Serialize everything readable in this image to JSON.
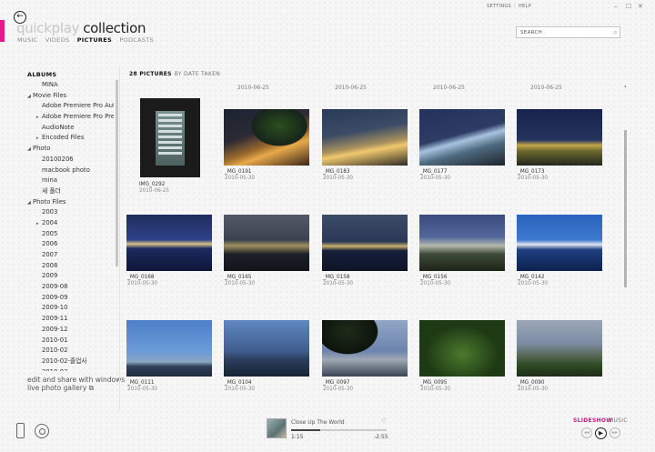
{
  "header": {
    "app_name": "quickplay",
    "section": "collection",
    "back_icon": "back-arrow-icon",
    "pivot": [
      "MUSIC",
      "VIDEOS",
      "PICTURES",
      "PODCASTS"
    ],
    "active_pivot": "PICTURES",
    "accent_color": "#e4198a"
  },
  "top_links": {
    "settings": "SETTINGS",
    "help": "HELP",
    "separator": "|"
  },
  "search": {
    "placeholder": "SEARCH",
    "icon": "search-icon"
  },
  "sidebar": {
    "title": "ALBUMS",
    "items": [
      {
        "label": "MINA",
        "indent": 1,
        "toggle": ""
      },
      {
        "label": "Movie Files",
        "indent": 0,
        "toggle": "◢"
      },
      {
        "label": "Adobe Premiere Pro Auto-Save",
        "indent": 1,
        "toggle": ""
      },
      {
        "label": "Adobe Premiere Pro Preview Files",
        "indent": 1,
        "toggle": "▸"
      },
      {
        "label": "AudioNote",
        "indent": 1,
        "toggle": ""
      },
      {
        "label": "Encoded Files",
        "indent": 1,
        "toggle": "▸"
      },
      {
        "label": "Photo",
        "indent": 0,
        "toggle": "◢"
      },
      {
        "label": "20100206",
        "indent": 1,
        "toggle": ""
      },
      {
        "label": "macbook photo",
        "indent": 1,
        "toggle": ""
      },
      {
        "label": "mina",
        "indent": 1,
        "toggle": ""
      },
      {
        "label": "새 폴더",
        "indent": 1,
        "toggle": ""
      },
      {
        "label": "Photo Files",
        "indent": 0,
        "toggle": "◢"
      },
      {
        "label": "2003",
        "indent": 1,
        "toggle": ""
      },
      {
        "label": "2004",
        "indent": 1,
        "toggle": "▸"
      },
      {
        "label": "2005",
        "indent": 1,
        "toggle": ""
      },
      {
        "label": "2006",
        "indent": 1,
        "toggle": ""
      },
      {
        "label": "2007",
        "indent": 1,
        "toggle": ""
      },
      {
        "label": "2008",
        "indent": 1,
        "toggle": ""
      },
      {
        "label": "2009",
        "indent": 1,
        "toggle": ""
      },
      {
        "label": "2009-08",
        "indent": 1,
        "toggle": ""
      },
      {
        "label": "2009-09",
        "indent": 1,
        "toggle": ""
      },
      {
        "label": "2009-10",
        "indent": 1,
        "toggle": ""
      },
      {
        "label": "2009-11",
        "indent": 1,
        "toggle": ""
      },
      {
        "label": "2009-12",
        "indent": 1,
        "toggle": ""
      },
      {
        "label": "2010-01",
        "indent": 1,
        "toggle": ""
      },
      {
        "label": "2010-02",
        "indent": 1,
        "toggle": ""
      },
      {
        "label": "2010-02-졸업사",
        "indent": 1,
        "toggle": ""
      },
      {
        "label": "2010-03",
        "indent": 1,
        "toggle": ""
      }
    ],
    "edit_link": "edit and share with windows live photo gallery"
  },
  "content": {
    "count": "28 PICTURES",
    "sort": "BY DATE TAKEN",
    "date_headers": [
      "2010-06-25",
      "2010-06-25",
      "2010-06-25",
      "2010-06-25"
    ],
    "photos": [
      {
        "name": "IMG_0292",
        "date": "2010-06-25",
        "kind": "phone",
        "bg": "#1b1b1b"
      },
      {
        "name": "_MG_0191",
        "date": "2010-05-30",
        "bg": "radial-gradient(ellipse at 65% 30%, #2b4e1f 0%, #16241a 35%, transparent 36%), linear-gradient(160deg, #1a2330 0%, #2c2a35 40%, #9b6a2d 60%, #e7a94a 70%, #3a2418 100%)"
      },
      {
        "name": "_MG_0183",
        "date": "2010-05-30",
        "bg": "linear-gradient(170deg, #283a58 0%, #3c4c66 40%, #a8905e 62%, #f0c86d 70%, #2d2a26 100%)"
      },
      {
        "name": "_MG_0177",
        "date": "2010-05-30",
        "bg": "linear-gradient(165deg, #23325a 0%, #2d3c64 45%, #a7c3e0 55%, #4e6a7e 70%, #1d242c 100%)"
      },
      {
        "name": "_MG_0173",
        "date": "2010-05-30",
        "bg": "linear-gradient(180deg, #16224a 0%, #26345e 55%, #c6a84a 64%, #6d6a30 74%, #23281e 100%)"
      },
      {
        "name": "_MG_0168",
        "date": "2010-05-30",
        "bg": "linear-gradient(180deg, #1f2d5c 0%, #30428a 45%, #d8c28a 52%, #1b2b5e 60%, #0f1638 100%)"
      },
      {
        "name": "_MG_0165",
        "date": "2010-05-30",
        "bg": "linear-gradient(180deg, #515a66 0%, #3b434f 45%, #a09060 55%, #1c2028 70%, #111419 100%)"
      },
      {
        "name": "_MG_0158",
        "date": "2010-05-30",
        "bg": "linear-gradient(180deg, #3d4c68 0%, #2b3858 48%, #c9b06c 56%, #17203a 64%, #0e1426 100%)"
      },
      {
        "name": "_MG_0156",
        "date": "2010-05-30",
        "bg": "linear-gradient(180deg, #3b4b7e 0%, #53679c 40%, #b5b8aa 55%, #3e4a3a 70%, #1c2418 100%)"
      },
      {
        "name": "_MG_0142",
        "date": "2010-05-30",
        "bg": "linear-gradient(180deg, #2a63bd 0%, #3c79cf 45%, #e2e6f0 53%, #1d3f82 62%, #0e214e 100%)"
      },
      {
        "name": "_MG_0111",
        "date": "2010-05-30",
        "bg": "linear-gradient(180deg, #4c80c8 0%, #6b9bd8 55%, #8aa4c0 74%, #31405a 82%, #1e2a3c 100%)"
      },
      {
        "name": "_MG_0104",
        "date": "2010-05-30",
        "bg": "linear-gradient(180deg, #6088c0 0%, #3f5d8e 55%, #2b3e5e 70%, #172233 100%)"
      },
      {
        "name": "_MG_0097",
        "date": "2010-05-30",
        "bg": "radial-gradient(ellipse at 30% 20%, #1f2b1a 0%, #0c130c 35%, transparent 36%), linear-gradient(180deg, #93a6c6 0%, #6b84ad 55%, #a0a8b2 70%, #3a4456 100%)"
      },
      {
        "name": "_MG_0095",
        "date": "2010-05-30",
        "bg": "radial-gradient(ellipse at 50% 60%, #4c7a2e 0%, #1e3a14 60%), linear-gradient(180deg, #274a18, #0f1a0a)"
      },
      {
        "name": "_MG_0090",
        "date": "2010-05-30",
        "bg": "linear-gradient(180deg, #9aa6b6 0%, #7e8ea6 40%, #5a6a5a 62%, #2e4a24 80%, #1e2c18 100%)"
      }
    ]
  },
  "now_playing": {
    "title": "Close Up The World",
    "elapsed": "1:15",
    "remaining": "-2:55",
    "progress": 0.3,
    "heart_icon": "heart-icon"
  },
  "playback": {
    "slideshow": "SLIDESHOW",
    "music": "MUSIC",
    "active_color": "#d0167f"
  },
  "footer_icons": [
    "device-icon",
    "disc-icon"
  ]
}
